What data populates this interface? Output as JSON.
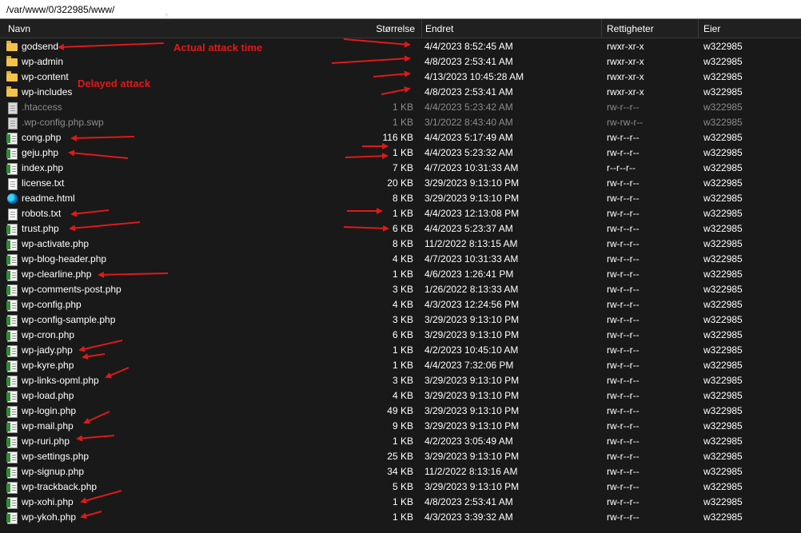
{
  "path": "/var/www/0/322985/www/",
  "columns": {
    "name": "Navn",
    "size": "Størrelse",
    "modified": "Endret",
    "permissions": "Rettigheter",
    "owner": "Eier"
  },
  "annotations": {
    "actual": "Actual attack time",
    "delayed": "Delayed attack"
  },
  "arrow_color": "#e01919",
  "files": [
    {
      "name": "godsend",
      "size": "",
      "date": "4/4/2023 8:52:45 AM",
      "perm": "rwxr-xr-x",
      "owner": "w322985",
      "icon": "folder-icon",
      "dim": false
    },
    {
      "name": "wp-admin",
      "size": "",
      "date": "4/8/2023 2:53:41 AM",
      "perm": "rwxr-xr-x",
      "owner": "w322985",
      "icon": "folder-icon",
      "dim": false
    },
    {
      "name": "wp-content",
      "size": "",
      "date": "4/13/2023 10:45:28 AM",
      "perm": "rwxr-xr-x",
      "owner": "w322985",
      "icon": "folder-icon",
      "dim": false
    },
    {
      "name": "wp-includes",
      "size": "",
      "date": "4/8/2023 2:53:41 AM",
      "perm": "rwxr-xr-x",
      "owner": "w322985",
      "icon": "folder-icon",
      "dim": false
    },
    {
      "name": ".htaccess",
      "size": "1 KB",
      "date": "4/4/2023 5:23:42 AM",
      "perm": "rw-r--r--",
      "owner": "w322985",
      "icon": "text-file-icon",
      "dim": true
    },
    {
      "name": ".wp-config.php.swp",
      "size": "1 KB",
      "date": "3/1/2022 8:43:40 AM",
      "perm": "rw-rw-r--",
      "owner": "w322985",
      "icon": "text-file-icon",
      "dim": true
    },
    {
      "name": "cong.php",
      "size": "116 KB",
      "date": "4/4/2023 5:17:49 AM",
      "perm": "rw-r--r--",
      "owner": "w322985",
      "icon": "php-file-icon",
      "dim": false
    },
    {
      "name": "geju.php",
      "size": "1 KB",
      "date": "4/4/2023 5:23:32 AM",
      "perm": "rw-r--r--",
      "owner": "w322985",
      "icon": "php-file-icon",
      "dim": false
    },
    {
      "name": "index.php",
      "size": "7 KB",
      "date": "4/7/2023 10:31:33 AM",
      "perm": "r--r--r--",
      "owner": "w322985",
      "icon": "php-file-icon",
      "dim": false
    },
    {
      "name": "license.txt",
      "size": "20 KB",
      "date": "3/29/2023 9:13:10 PM",
      "perm": "rw-r--r--",
      "owner": "w322985",
      "icon": "text-file-icon",
      "dim": false
    },
    {
      "name": "readme.html",
      "size": "8 KB",
      "date": "3/29/2023 9:13:10 PM",
      "perm": "rw-r--r--",
      "owner": "w322985",
      "icon": "edge-html-icon",
      "dim": false
    },
    {
      "name": "robots.txt",
      "size": "1 KB",
      "date": "4/4/2023 12:13:08 PM",
      "perm": "rw-r--r--",
      "owner": "w322985",
      "icon": "text-file-icon",
      "dim": false
    },
    {
      "name": "trust.php",
      "size": "6 KB",
      "date": "4/4/2023 5:23:37 AM",
      "perm": "rw-r--r--",
      "owner": "w322985",
      "icon": "php-file-icon",
      "dim": false
    },
    {
      "name": "wp-activate.php",
      "size": "8 KB",
      "date": "11/2/2022 8:13:15 AM",
      "perm": "rw-r--r--",
      "owner": "w322985",
      "icon": "php-file-icon",
      "dim": false
    },
    {
      "name": "wp-blog-header.php",
      "size": "4 KB",
      "date": "4/7/2023 10:31:33 AM",
      "perm": "rw-r--r--",
      "owner": "w322985",
      "icon": "php-file-icon",
      "dim": false
    },
    {
      "name": "wp-clearline.php",
      "size": "1 KB",
      "date": "4/6/2023 1:26:41 PM",
      "perm": "rw-r--r--",
      "owner": "w322985",
      "icon": "php-file-icon",
      "dim": false
    },
    {
      "name": "wp-comments-post.php",
      "size": "3 KB",
      "date": "1/26/2022 8:13:33 AM",
      "perm": "rw-r--r--",
      "owner": "w322985",
      "icon": "php-file-icon",
      "dim": false
    },
    {
      "name": "wp-config.php",
      "size": "4 KB",
      "date": "4/3/2023 12:24:56 PM",
      "perm": "rw-r--r--",
      "owner": "w322985",
      "icon": "php-file-icon",
      "dim": false
    },
    {
      "name": "wp-config-sample.php",
      "size": "3 KB",
      "date": "3/29/2023 9:13:10 PM",
      "perm": "rw-r--r--",
      "owner": "w322985",
      "icon": "php-file-icon",
      "dim": false
    },
    {
      "name": "wp-cron.php",
      "size": "6 KB",
      "date": "3/29/2023 9:13:10 PM",
      "perm": "rw-r--r--",
      "owner": "w322985",
      "icon": "php-file-icon",
      "dim": false
    },
    {
      "name": "wp-jady.php",
      "size": "1 KB",
      "date": "4/2/2023 10:45:10 AM",
      "perm": "rw-r--r--",
      "owner": "w322985",
      "icon": "php-file-icon",
      "dim": false
    },
    {
      "name": "wp-kyre.php",
      "size": "1 KB",
      "date": "4/4/2023 7:32:06 PM",
      "perm": "rw-r--r--",
      "owner": "w322985",
      "icon": "php-file-icon",
      "dim": false
    },
    {
      "name": "wp-links-opml.php",
      "size": "3 KB",
      "date": "3/29/2023 9:13:10 PM",
      "perm": "rw-r--r--",
      "owner": "w322985",
      "icon": "php-file-icon",
      "dim": false
    },
    {
      "name": "wp-load.php",
      "size": "4 KB",
      "date": "3/29/2023 9:13:10 PM",
      "perm": "rw-r--r--",
      "owner": "w322985",
      "icon": "php-file-icon",
      "dim": false
    },
    {
      "name": "wp-login.php",
      "size": "49 KB",
      "date": "3/29/2023 9:13:10 PM",
      "perm": "rw-r--r--",
      "owner": "w322985",
      "icon": "php-file-icon",
      "dim": false
    },
    {
      "name": "wp-mail.php",
      "size": "9 KB",
      "date": "3/29/2023 9:13:10 PM",
      "perm": "rw-r--r--",
      "owner": "w322985",
      "icon": "php-file-icon",
      "dim": false
    },
    {
      "name": "wp-ruri.php",
      "size": "1 KB",
      "date": "4/2/2023 3:05:49 AM",
      "perm": "rw-r--r--",
      "owner": "w322985",
      "icon": "php-file-icon",
      "dim": false
    },
    {
      "name": "wp-settings.php",
      "size": "25 KB",
      "date": "3/29/2023 9:13:10 PM",
      "perm": "rw-r--r--",
      "owner": "w322985",
      "icon": "php-file-icon",
      "dim": false
    },
    {
      "name": "wp-signup.php",
      "size": "34 KB",
      "date": "11/2/2022 8:13:16 AM",
      "perm": "rw-r--r--",
      "owner": "w322985",
      "icon": "php-file-icon",
      "dim": false
    },
    {
      "name": "wp-trackback.php",
      "size": "5 KB",
      "date": "3/29/2023 9:13:10 PM",
      "perm": "rw-r--r--",
      "owner": "w322985",
      "icon": "php-file-icon",
      "dim": false
    },
    {
      "name": "wp-xohi.php",
      "size": "1 KB",
      "date": "4/8/2023 2:53:41 AM",
      "perm": "rw-r--r--",
      "owner": "w322985",
      "icon": "php-file-icon",
      "dim": false
    },
    {
      "name": "wp-ykoh.php",
      "size": "1 KB",
      "date": "4/3/2023 3:39:32 AM",
      "perm": "rw-r--r--",
      "owner": "w322985",
      "icon": "php-file-icon",
      "dim": false
    }
  ]
}
